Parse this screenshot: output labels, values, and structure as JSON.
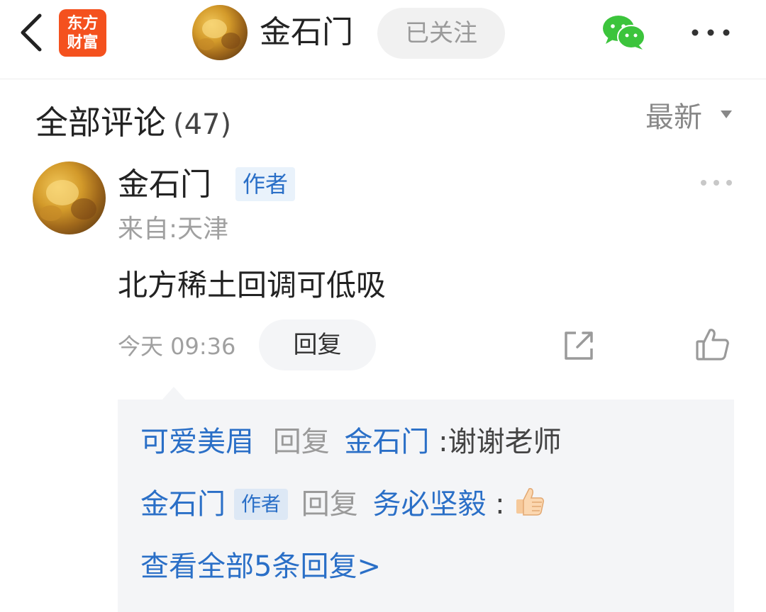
{
  "header": {
    "app_logo_line1": "东方",
    "app_logo_line2": "财富",
    "user_name": "金石门",
    "follow_label": "已关注"
  },
  "comments_section": {
    "title": "全部评论",
    "count": "(47)",
    "sort_label": "最新"
  },
  "comment": {
    "author": "金石门",
    "author_tag": "作者",
    "location": "来自:天津",
    "content": "北方稀土回调可低吸",
    "time": "今天 09:36",
    "reply_button": "回复"
  },
  "replies": [
    {
      "from": "可爱美眉",
      "verb": "回复",
      "to": "金石门",
      "sep": ":",
      "text": "谢谢老师"
    },
    {
      "from": "金石门",
      "from_tag": "作者",
      "verb": "回复",
      "to": "务必坚毅",
      "sep": ":",
      "emoji": "thumbs-up"
    }
  ],
  "view_all_label": "查看全部5条回复>",
  "colors": {
    "accent_blue": "#2a6fc7",
    "brand_orange": "#f4511e",
    "wechat_green": "#3cc43c",
    "muted_grey": "#9a9a9a"
  }
}
